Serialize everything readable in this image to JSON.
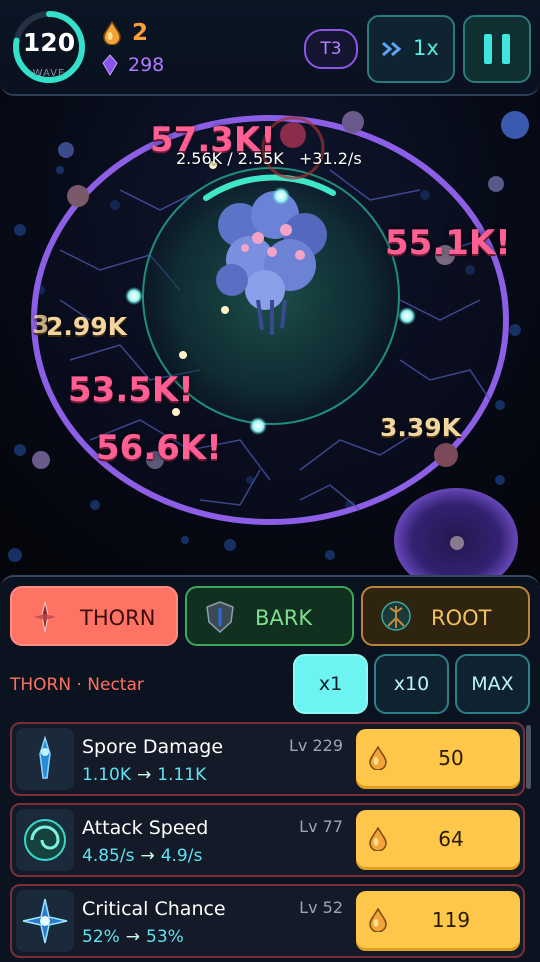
{
  "hud": {
    "wave_number": "120",
    "wave_label": "WAVE",
    "wave_progress": 0.78,
    "amber": "2",
    "gems": "298",
    "tier": "T3",
    "speed": "1x"
  },
  "battle": {
    "hp_text": "2.56K / 2.55K",
    "regen_text": "+31.2/s",
    "damage_numbers": [
      "57.3K!",
      "55.1K!",
      "53.5K!",
      "56.6K!",
      "2.99K",
      "3.39K",
      "3"
    ]
  },
  "tabs": {
    "thorn": "THORN",
    "bark": "BARK",
    "root": "ROOT",
    "active": "THORN"
  },
  "section_title": "THORN · Nectar",
  "multipliers": {
    "x1": "x1",
    "x10": "x10",
    "max": "MAX",
    "selected": "x1"
  },
  "upgrades": [
    {
      "name": "Spore Damage",
      "level": "Lv 229",
      "current": "1.10K",
      "next": "1.11K",
      "cost": "50",
      "icon": "spore-blade-icon"
    },
    {
      "name": "Attack Speed",
      "level": "Lv 77",
      "current": "4.85/s",
      "next": "4.9/s",
      "cost": "64",
      "icon": "swirl-icon"
    },
    {
      "name": "Critical Chance",
      "level": "Lv 52",
      "current": "52%",
      "next": "53%",
      "cost": "119",
      "icon": "starburst-icon"
    }
  ],
  "colors": {
    "crit_text": "#ff5f93",
    "normal_text": "#f3d5a0",
    "accent_cyan": "#4ff0e6",
    "thorn_tab": "#ff7364",
    "bark_tab": "#3ca85c",
    "root_tab": "#b8863a",
    "buy_button": "#ffc74a"
  }
}
